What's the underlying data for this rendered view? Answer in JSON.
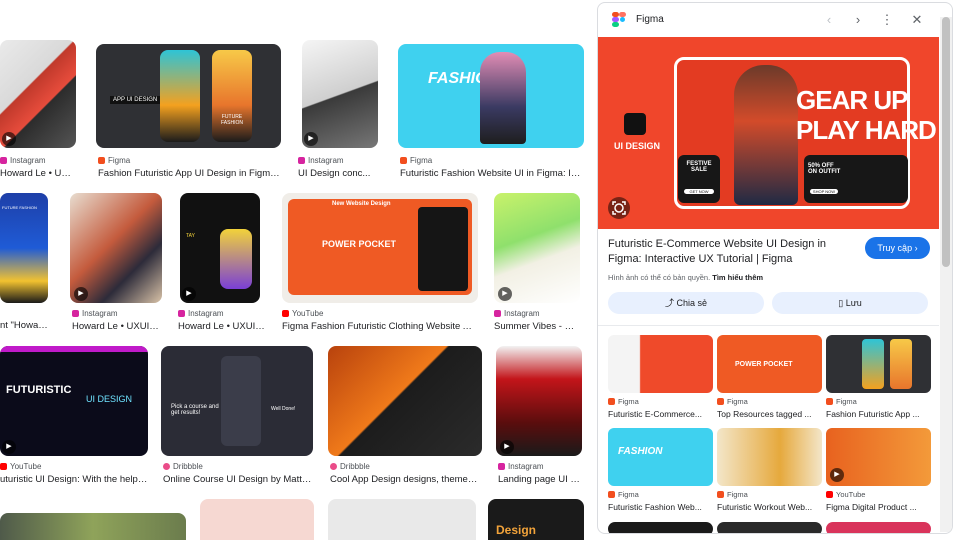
{
  "grid": [
    {
      "source": "Instagram",
      "source_color": "#d6249f",
      "title": "Howard Le • UXUI ..."
    },
    {
      "source": "Figma",
      "source_color": "#f24e1e",
      "title": "Fashion Futuristic App UI Design in Figma: ..."
    },
    {
      "source": "Instagram",
      "source_color": "#d6249f",
      "title": "UI Design conc..."
    },
    {
      "source": "Figma",
      "source_color": "#f24e1e",
      "title": "Futuristic Fashion Website UI in Figma: Inte..."
    },
    {
      "source": "",
      "source_color": "#ffffff",
      "title": "nt \"Howardl..."
    },
    {
      "source": "Instagram",
      "source_color": "#d6249f",
      "title": "Howard Le • UXUI |..."
    },
    {
      "source": "Instagram",
      "source_color": "#d6249f",
      "title": "Howard Le • UXUI |..."
    },
    {
      "source": "YouTube",
      "source_color": "#ff0000",
      "title": "Figma Fashion Futuristic Clothing Website Adv..."
    },
    {
      "source": "Instagram",
      "source_color": "#d6249f",
      "title": "Summer Vibes - Co..."
    },
    {
      "source": "YouTube",
      "source_color": "#ff0000",
      "title": "uturistic UI Design: With the help ..."
    },
    {
      "source": "Dribbble",
      "source_color": "#ea4c89",
      "title": "Online Course UI Design by Matt o..."
    },
    {
      "source": "Dribbble",
      "source_color": "#ea4c89",
      "title": "Cool App Design designs, themes, t..."
    },
    {
      "source": "Instagram",
      "source_color": "#d6249f",
      "title": "Landing page UI m..."
    }
  ],
  "grid_text": {
    "t2_banner": "APP UI DESIGN",
    "t2_label": "FUTURE FASHION",
    "t4_label": "FASHION",
    "t8_head": "New Website Design",
    "t8_mid": "POWER POCKET",
    "t9_label": "TAY",
    "t10_label": "FUTURISTIC",
    "t10_sub": "UI DESIGN",
    "t11_label": "Pick a course and get results!",
    "t11_btn": "Well Done!",
    "t13_label": "Design",
    "t5_tag": "FUTURE FASHION"
  },
  "panel": {
    "site_name": "Figma",
    "hero_brand": "UI DESIGN",
    "hero_headline_1": "GEAR UP",
    "hero_headline_2": "PLAY HARD",
    "hero_sale": "FESTIVE SALE",
    "hero_sale_btn": "GET NOW",
    "hero_offer": "50% OFF ON OUTFIT",
    "hero_offer_btn": "SHOP NOW",
    "title": "Futuristic E-Commerce Website UI Design in Figma: Interactive UX Tutorial | Figma",
    "visit_label": "Truy cập",
    "note_text": "Hình ảnh có thể có bản quyền.",
    "note_link": "Tìm hiểu thêm",
    "share_label": "Chia sẻ",
    "save_label": "Lưu",
    "related": [
      {
        "source": "Figma",
        "source_color": "#f24e1e",
        "title": "Futuristic E-Commerce..."
      },
      {
        "source": "Figma",
        "source_color": "#f24e1e",
        "title": "Top Resources tagged ..."
      },
      {
        "source": "Figma",
        "source_color": "#f24e1e",
        "title": "Fashion Futuristic App ..."
      },
      {
        "source": "Figma",
        "source_color": "#f24e1e",
        "title": "Futuristic Fashion Web..."
      },
      {
        "source": "Figma",
        "source_color": "#f24e1e",
        "title": "Futuristic Workout Web..."
      },
      {
        "source": "YouTube",
        "source_color": "#ff0000",
        "title": "Figma Digital Product ..."
      }
    ],
    "related_text": {
      "r2_mid": "POWER POCKET",
      "r4_label": "FASHION"
    }
  },
  "icons": {
    "prev": "chevron-left-icon",
    "next": "chevron-right-icon",
    "more": "more-vert-icon",
    "close": "close-icon",
    "lens": "lens-icon",
    "share": "share-icon",
    "bookmark": "bookmark-icon",
    "play": "play-icon"
  },
  "colors": {
    "accent": "#1a73e8",
    "hero_bg": "#f0462b",
    "pill_bg": "#e8f0fe"
  }
}
